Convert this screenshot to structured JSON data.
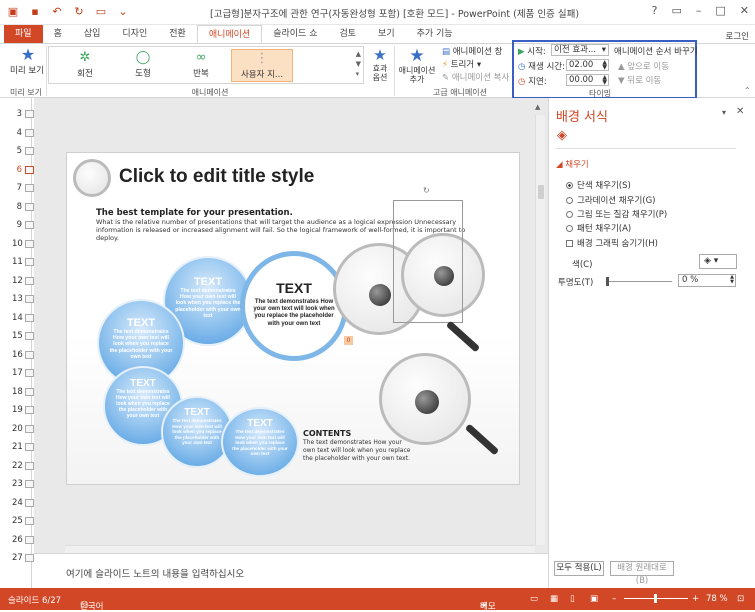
{
  "window": {
    "title": "[고급형]분자구조에 관한 연구(자동완성형 포함) [호환 모드] - PowerPoint (제품 인증 실패)",
    "controls": [
      "?",
      "▭",
      "–",
      "□",
      "✕"
    ],
    "login": "로그인"
  },
  "tabs": [
    "파일",
    "홈",
    "삽입",
    "디자인",
    "전환",
    "애니메이션",
    "슬라이드 쇼",
    "검토",
    "보기",
    "추가 기능"
  ],
  "active_tab": "애니메이션",
  "ribbon": {
    "preview_label": "미리 보기",
    "preview_group": "미리 보기",
    "gallery": [
      "회전",
      "도형",
      "반복",
      "사용자 지..."
    ],
    "gallery_group": "애니메이션",
    "effect_options": "효과 옵션",
    "add_animation": "애니메이션 추가",
    "anim_pane": "애니메이션 창",
    "trigger": "트리거",
    "anim_copy": "애니메이션 복사",
    "advanced_group": "고급 애니메이션",
    "timing": {
      "start_label": "시작:",
      "start_value": "이전 효과...",
      "duration_label": "재생 시간:",
      "duration_value": "02.00",
      "delay_label": "지연:",
      "delay_value": "00.00",
      "reorder_label": "애니메이션 순서 바꾸기",
      "move_earlier": "앞으로 이동",
      "move_later": "뒤로 이동",
      "group_label": "타이밍"
    }
  },
  "thumbnails": [
    "3",
    "4",
    "5",
    "6",
    "7",
    "8",
    "9",
    "10",
    "11",
    "12",
    "13",
    "14",
    "15",
    "16",
    "17",
    "18",
    "19",
    "20",
    "21",
    "22",
    "23",
    "24",
    "25",
    "26",
    "27"
  ],
  "active_slide": "6",
  "slide": {
    "title": "Click to edit title style",
    "subtitle": "The best template for your presentation.",
    "description": "What is the relative number of presentations that will target the audience as a logical expression Unnecessary information is released or increased alignment will fail. So the logical framework of well-formed, it is important to deploy.",
    "circles": [
      {
        "head": "TEXT",
        "body": "The text demonstrates How your own text will look when you replace the placeholder with your own text"
      },
      {
        "head": "TEXT",
        "body": "The text demonstrates How your own text will look when you replace the placeholder with your own text"
      },
      {
        "head": "TEXT",
        "body": "The text demonstrates How your own text will look when you replace the placeholder with your own text"
      },
      {
        "head": "TEXT",
        "body": "The text demonstrates How your own text will look when you replace the placeholder with your own text"
      },
      {
        "head": "TEXT",
        "body": "The text demonstrates How your own text will look when you replace the placeholder with your own text"
      }
    ],
    "big_circle": {
      "head": "TEXT",
      "body": "The text demonstrates How your own text will look when you replace the placeholder with your own text"
    },
    "contents_head": "CONTENTS",
    "contents_body": "The text demonstrates How your own text will look when you replace the placeholder with your own text.",
    "anim_tag": "0"
  },
  "notes_placeholder": "여기에 슬라이드 노트의 내용을 입력하십시오",
  "format_pane": {
    "title": "배경 서식",
    "section": "채우기",
    "options": [
      {
        "label": "단색 채우기(S)",
        "checked": true
      },
      {
        "label": "그라데이션 채우기(G)",
        "checked": false
      },
      {
        "label": "그림 또는 질감 채우기(P)",
        "checked": false
      },
      {
        "label": "패턴 채우기(A)",
        "checked": false
      }
    ],
    "hide_graphics": "배경 그래픽 숨기기(H)",
    "color_label": "색(C)",
    "transparency_label": "투명도(T)",
    "transparency_value": "0 %",
    "apply_all": "모두 적용(L)",
    "reset": "배경 원래대로(B)"
  },
  "status": {
    "slide": "슬라이드 6/27",
    "language": "한국어",
    "notes": "메모",
    "zoom": "78 %"
  },
  "colors": {
    "accent": "#d24726",
    "timing_highlight": "#3a5fc4"
  }
}
